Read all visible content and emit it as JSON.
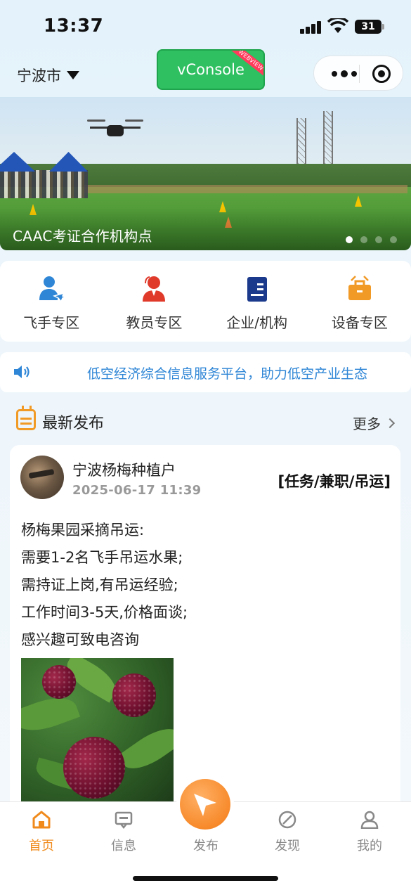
{
  "status_bar": {
    "time": "13:37",
    "battery": "31"
  },
  "nav": {
    "city": "宁波市",
    "vconsole_label": "vConsole",
    "vconsole_ribbon": "WEBVIEW"
  },
  "banner": {
    "caption": "CAAC考证合作机构点",
    "slide_count": 4,
    "active_slide": 1
  },
  "quick_entries": [
    {
      "label": "飞手专区",
      "icon": "pilot-icon",
      "color": "#2f86d6"
    },
    {
      "label": "教员专区",
      "icon": "instructor-icon",
      "color": "#e03a2b"
    },
    {
      "label": "企业/机构",
      "icon": "company-icon",
      "color": "#1c3a8c"
    },
    {
      "label": "设备专区",
      "icon": "equipment-icon",
      "color": "#f19a26"
    }
  ],
  "notice": {
    "text": "低空经济综合信息服务平台，助力低空产业生态"
  },
  "section": {
    "title": "最新发布",
    "more_label": "更多"
  },
  "post": {
    "author": "宁波杨梅种植户",
    "time": "2025-06-17 11:39",
    "tag": "[任务/兼职/吊运]",
    "lines": [
      "杨梅果园采摘吊运:",
      "需要1-2名飞手吊运水果;",
      "需持证上岗,有吊运经验;",
      "工作时间3-5天,价格面谈;",
      "感兴趣可致电咨询"
    ]
  },
  "tabbar": {
    "active": "首页",
    "tabs": [
      {
        "label": "首页",
        "icon": "home-icon"
      },
      {
        "label": "信息",
        "icon": "message-icon"
      },
      {
        "label": "发布",
        "icon": "publish-icon"
      },
      {
        "label": "发现",
        "icon": "discover-icon"
      },
      {
        "label": "我的",
        "icon": "profile-icon"
      }
    ]
  },
  "colors": {
    "accent": "#f08a1c",
    "link": "#2f86d6",
    "vconsole": "#2ec061"
  }
}
